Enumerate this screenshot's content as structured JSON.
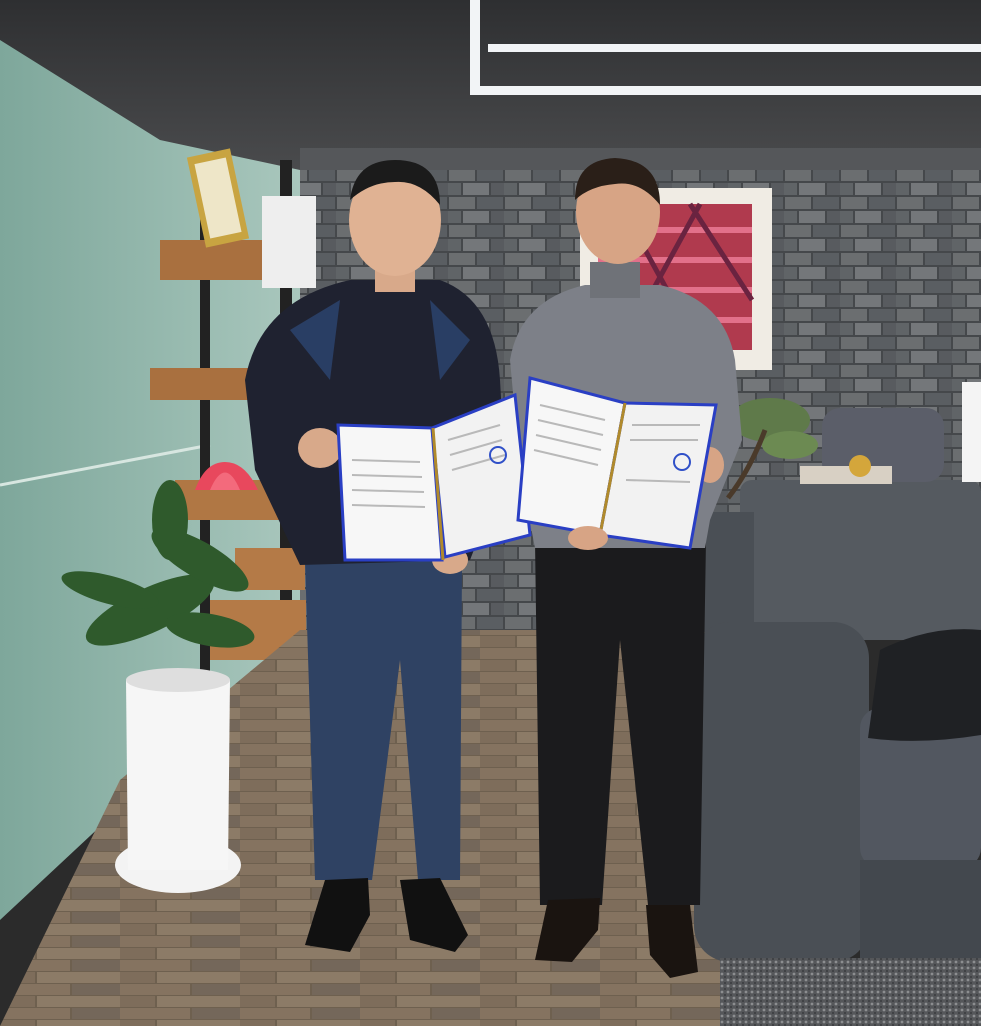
{
  "photo": {
    "subject": "contract-signing-photo",
    "people": [
      {
        "side": "left",
        "top_color": "#1f2230",
        "pants_color": "#2f4263"
      },
      {
        "side": "right",
        "top_color": "#7d8088",
        "pants_color": "#1b1b1d"
      }
    ],
    "colors": {
      "ceiling": "#3a3b3d",
      "brick_wall": "#5a5d60",
      "glass_wall": "#8fb3a8",
      "floor": "#7a6a58",
      "sofa": "#4a4f55",
      "folder_edge": "#2a3fc4",
      "light_strip": "#f2f4f6"
    },
    "icons": [
      "plant-icon",
      "lotus-lamp-icon",
      "certificate-frame-icon",
      "office-chair-icon"
    ]
  }
}
